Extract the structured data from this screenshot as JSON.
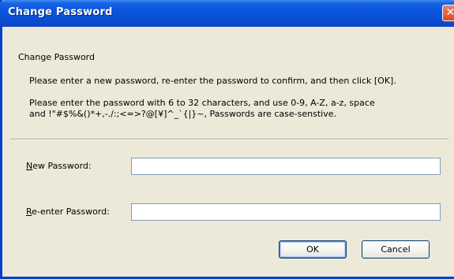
{
  "window": {
    "title": "Change Password",
    "close_glyph": "✕"
  },
  "content": {
    "heading": "Change Password",
    "instruction": "Please enter a new password, re-enter the password to confirm, and then click [OK].",
    "rules_line1": "Please enter the password with 6 to 32 characters, and use 0-9, A-Z, a-z, space",
    "rules_line2": "and !\"#$%&()*+,-./:;<=>?@[¥]^_`{|}~, Passwords are case-senstive."
  },
  "form": {
    "new_password": {
      "label_accel": "N",
      "label_rest": "ew Password:",
      "value": ""
    },
    "reenter_password": {
      "label_accel": "R",
      "label_rest": "e-enter Password:",
      "value": ""
    }
  },
  "buttons": {
    "ok": "OK",
    "cancel": "Cancel"
  }
}
